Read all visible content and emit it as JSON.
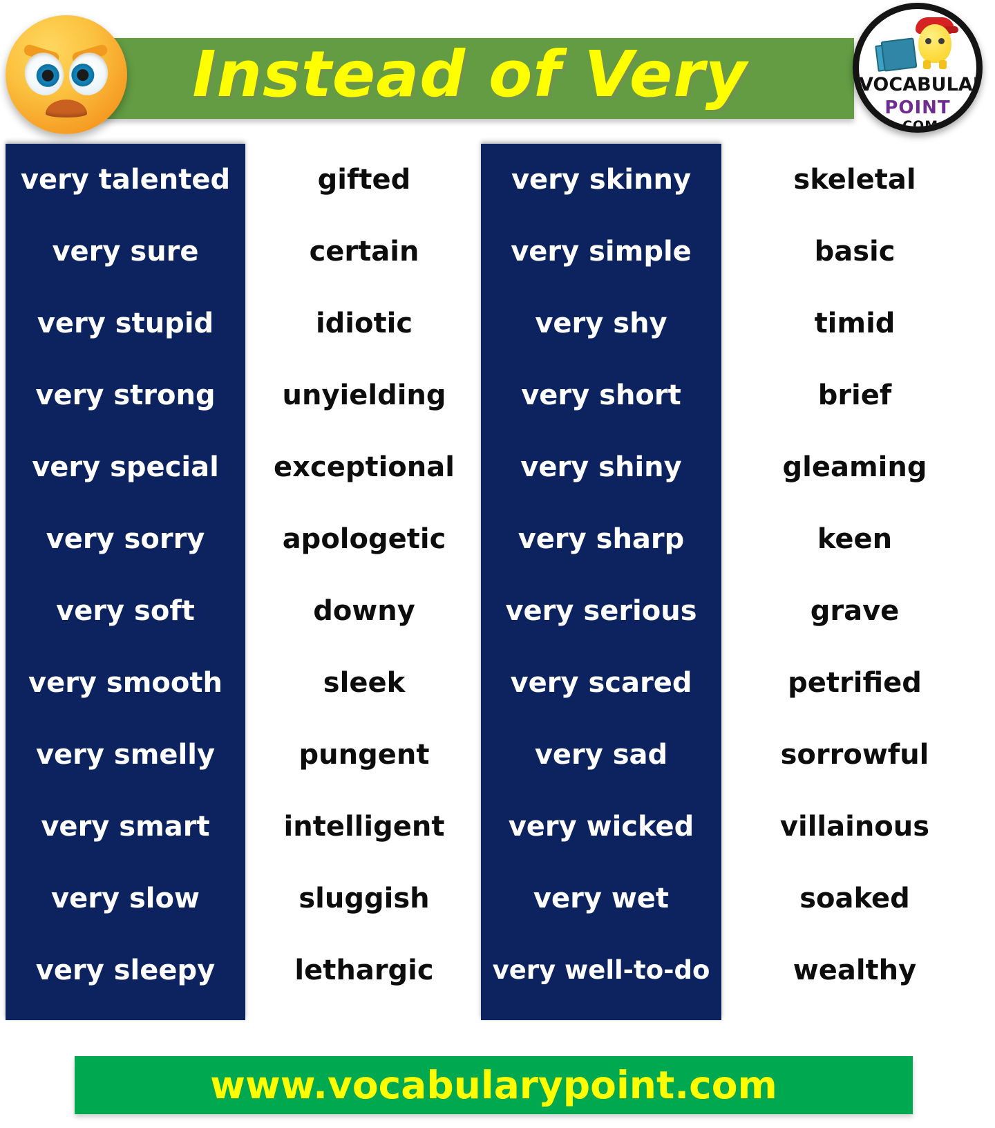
{
  "header": {
    "title": "Instead of Very",
    "bar_color": "#639c43",
    "title_color": "#ffff00",
    "emoji": "angry-face-emoji",
    "logo": {
      "line1": "VOCABULARY",
      "line2": "POINT",
      "line3": ".COM",
      "line2_color": "#6f2d91"
    }
  },
  "table": {
    "panel_color": "#0c2360",
    "columns": [
      {
        "name": "phrases-left",
        "style": "blue",
        "items": [
          "very talented",
          "very sure",
          "very stupid",
          "very strong",
          "very special",
          "very sorry",
          "very soft",
          "very smooth",
          "very smelly",
          "very smart",
          "very slow",
          "very sleepy"
        ]
      },
      {
        "name": "synonyms-left",
        "style": "white",
        "items": [
          "gifted",
          "certain",
          "idiotic",
          "unyielding",
          "exceptional",
          "apologetic",
          "downy",
          "sleek",
          "pungent",
          "intelligent",
          "sluggish",
          "lethargic"
        ]
      },
      {
        "name": "phrases-right",
        "style": "blue",
        "items": [
          "very skinny",
          "very simple",
          "very shy",
          "very short",
          "very shiny",
          "very sharp",
          "very serious",
          "very scared",
          "very sad",
          "very wicked",
          "very wet",
          "very well-to-do"
        ]
      },
      {
        "name": "synonyms-right",
        "style": "white",
        "items": [
          "skeletal",
          "basic",
          "timid",
          "brief",
          "gleaming",
          "keen",
          "grave",
          "petrified",
          "sorrowful",
          "villainous",
          "soaked",
          "wealthy"
        ]
      }
    ]
  },
  "footer": {
    "url": "www.vocabularypoint.com",
    "bar_color": "#00a84f",
    "text_color": "#ffff00"
  }
}
